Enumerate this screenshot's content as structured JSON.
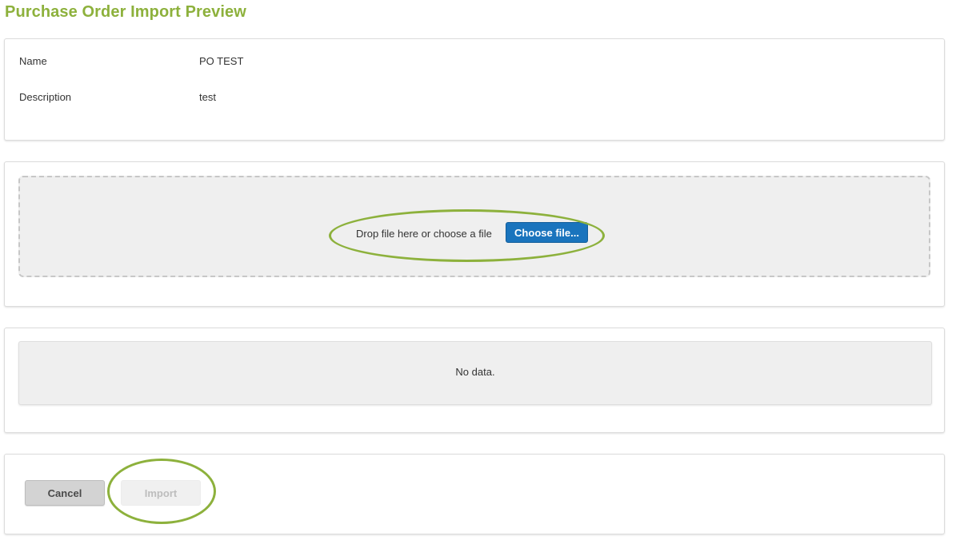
{
  "page": {
    "title": "Purchase Order Import Preview"
  },
  "info": {
    "name_label": "Name",
    "name_value": "PO TEST",
    "description_label": "Description",
    "description_value": "test"
  },
  "upload": {
    "prompt": "Drop file here or choose a file",
    "choose_button_label": "Choose file..."
  },
  "data_table": {
    "empty_message": "No data."
  },
  "actions": {
    "cancel_label": "Cancel",
    "import_label": "Import",
    "import_enabled": false
  },
  "colors": {
    "title_green": "#8db13c",
    "highlight_green": "#8db13c",
    "primary_blue": "#1a74bd"
  }
}
